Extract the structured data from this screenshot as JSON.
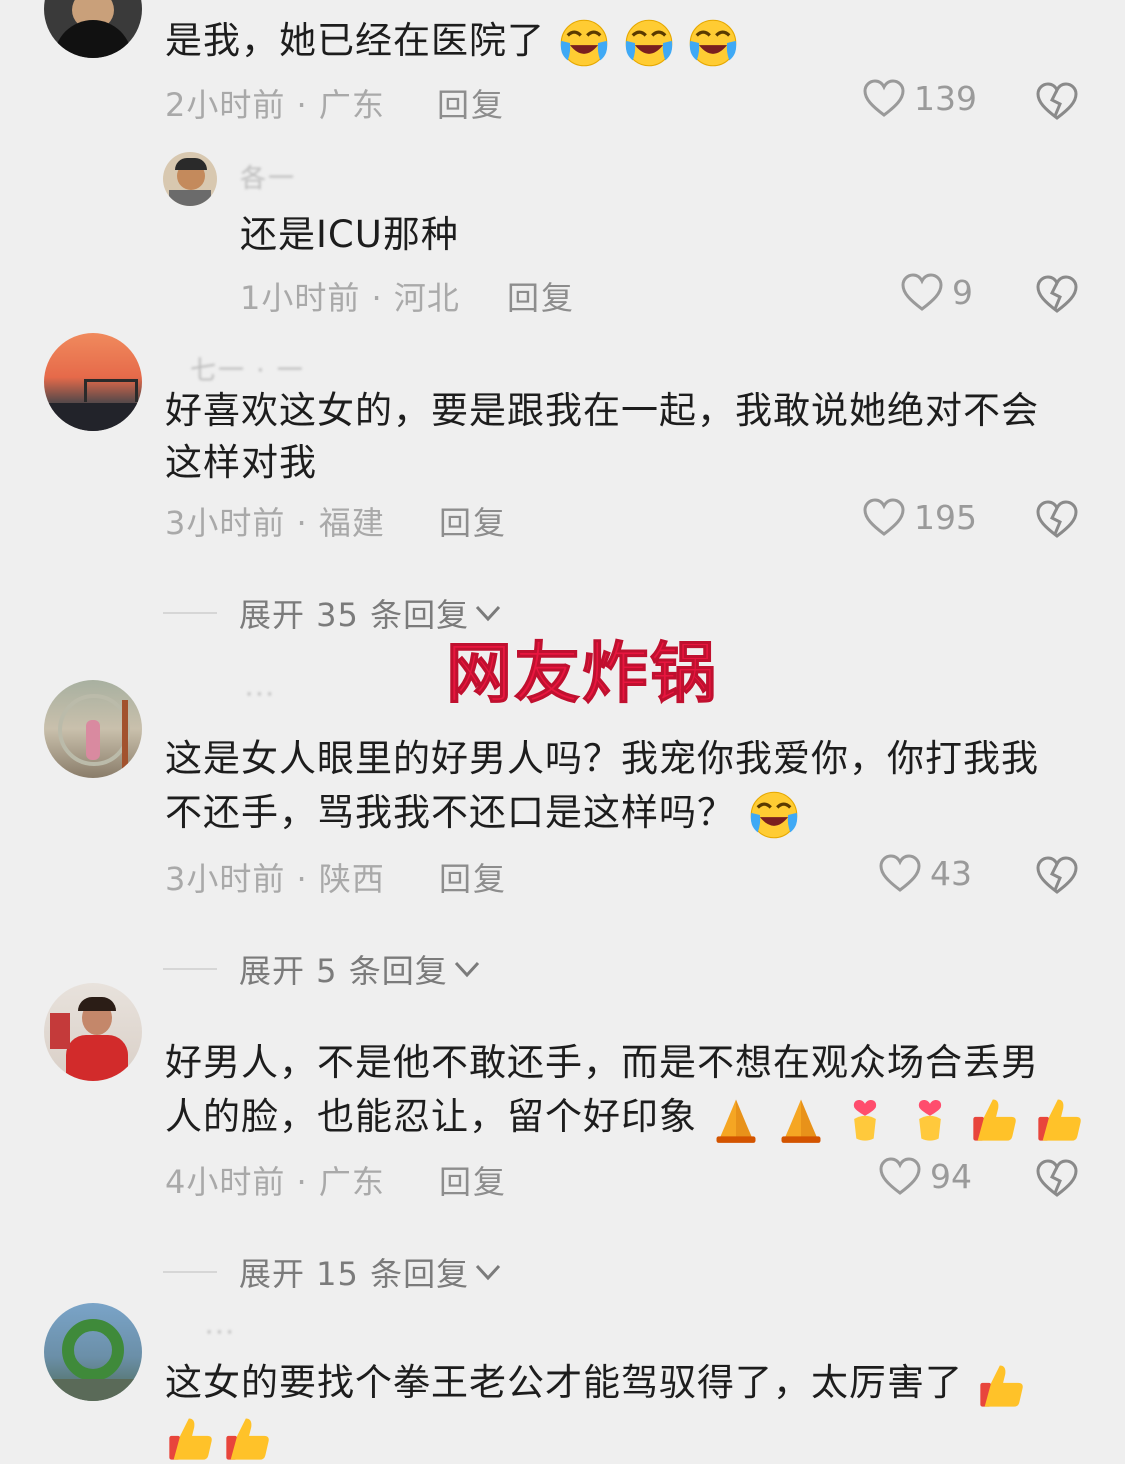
{
  "overlay_title": "网友炸锅",
  "comments": [
    {
      "text": "是我，她已经在医院了",
      "meta": "2小时前 · 广东",
      "reply": "回复",
      "likes": "139",
      "emoji": "laugh-cry-icon x3"
    },
    {
      "name": "各一",
      "text": "还是ICU那种",
      "meta": "1小时前 · 河北",
      "reply": "回复",
      "likes": "9"
    },
    {
      "name": "七一 · 一",
      "text_line1": "好喜欢这女的，要是跟我在一起，我敢说她绝对不会",
      "text_line2": "这样对我",
      "meta": "3小时前 · 福建",
      "reply": "回复",
      "likes": "195",
      "expand": "展开 35 条回复"
    },
    {
      "name": "···",
      "text_line1": "这是女人眼里的好男人吗？我宠你我爱你，你打我我",
      "text_line2": "不还手，骂我我不还口是这样吗？",
      "meta": "3小时前 · 陕西",
      "reply": "回复",
      "likes": "43",
      "expand": "展开 5 条回复"
    },
    {
      "text_line1": "好男人，不是他不敢还手，而是不想在观众场合丢男",
      "text_line2": "人的脸，也能忍让，留个好印象",
      "meta": "4小时前 · 广东",
      "reply": "回复",
      "likes": "94",
      "expand": "展开 15 条回复"
    },
    {
      "name": "···",
      "text_line1": "这女的要找个拳王老公才能驾驭得了，太厉害了"
    }
  ],
  "colors": {
    "background": "#efefef",
    "overlay": "#e8163f",
    "meta": "#a9a9a9"
  }
}
